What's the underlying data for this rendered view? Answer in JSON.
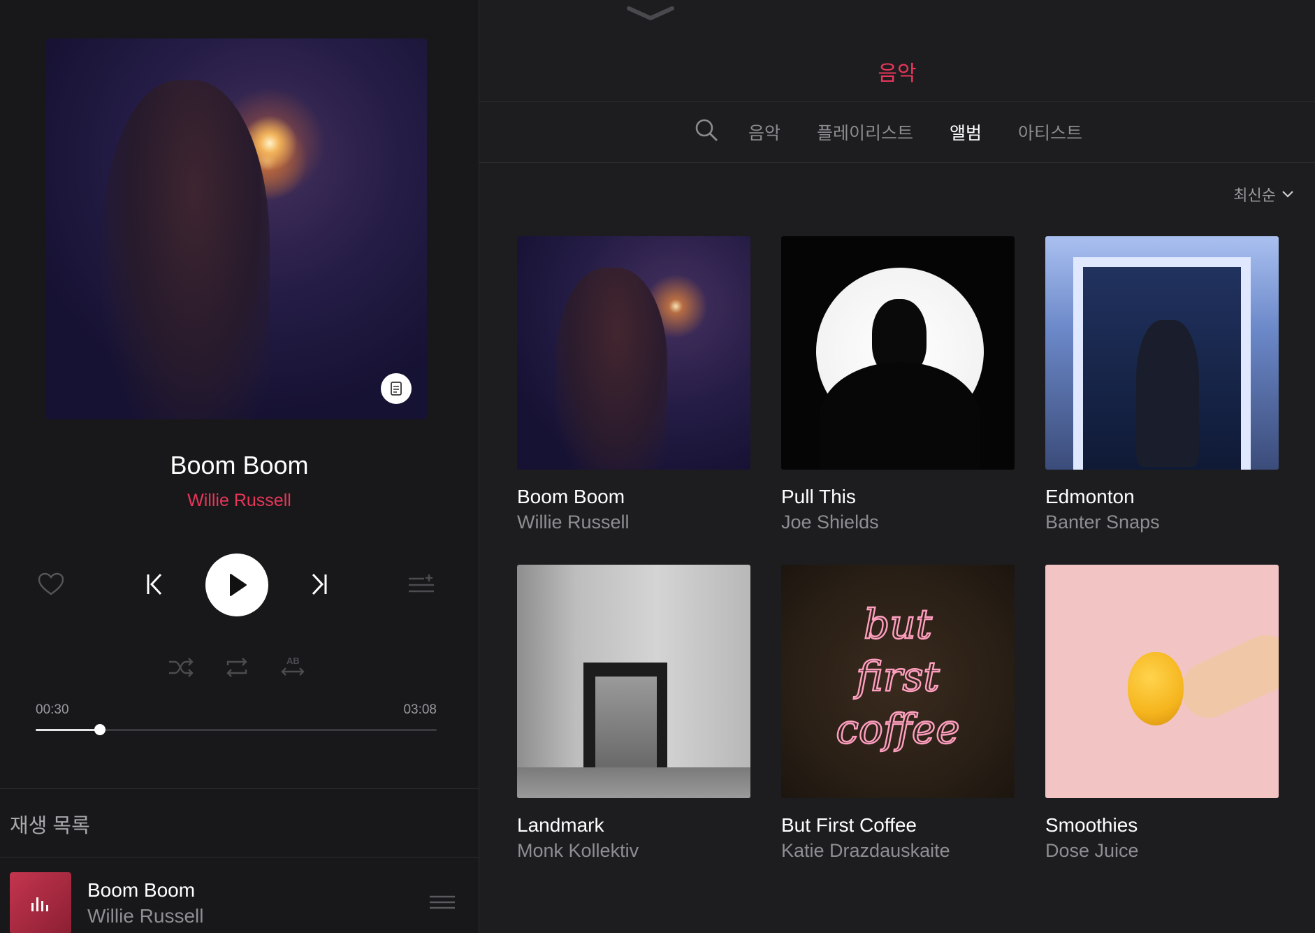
{
  "now_playing": {
    "title": "Boom Boom",
    "artist": "Willie Russell",
    "elapsed": "00:30",
    "duration": "03:08",
    "progress": 0.16,
    "icons": {
      "lyrics": "lyrics-doc-icon",
      "favorite": "heart-icon",
      "previous": "skip-previous-icon",
      "play": "play-icon",
      "next": "skip-next-icon",
      "add_to_queue": "add-to-queue-icon",
      "shuffle": "shuffle-icon",
      "repeat": "repeat-icon",
      "ab_repeat": "ab-repeat-icon"
    }
  },
  "queue": {
    "title": "재생 목록",
    "items": [
      {
        "title": "Boom Boom",
        "artist": "Willie Russell"
      }
    ]
  },
  "library": {
    "header": "음악",
    "tabs": [
      {
        "label": "음악",
        "active": false
      },
      {
        "label": "플레이리스트",
        "active": false
      },
      {
        "label": "앨범",
        "active": true
      },
      {
        "label": "아티스트",
        "active": false
      }
    ],
    "sort_label": "최신순",
    "albums": [
      {
        "title": "Boom Boom",
        "artist": "Willie Russell"
      },
      {
        "title": "Pull This",
        "artist": "Joe Shields"
      },
      {
        "title": "Edmonton",
        "artist": "Banter Snaps"
      },
      {
        "title": "Landmark",
        "artist": "Monk Kollektiv"
      },
      {
        "title": "But First Coffee",
        "artist": "Katie Drazdauskaite"
      },
      {
        "title": "Smoothies",
        "artist": "Dose Juice"
      }
    ]
  },
  "colors": {
    "accent": "#e8365a",
    "background": "#1b1b1d",
    "panel": "#18181a",
    "muted_text": "#8e8e93"
  }
}
